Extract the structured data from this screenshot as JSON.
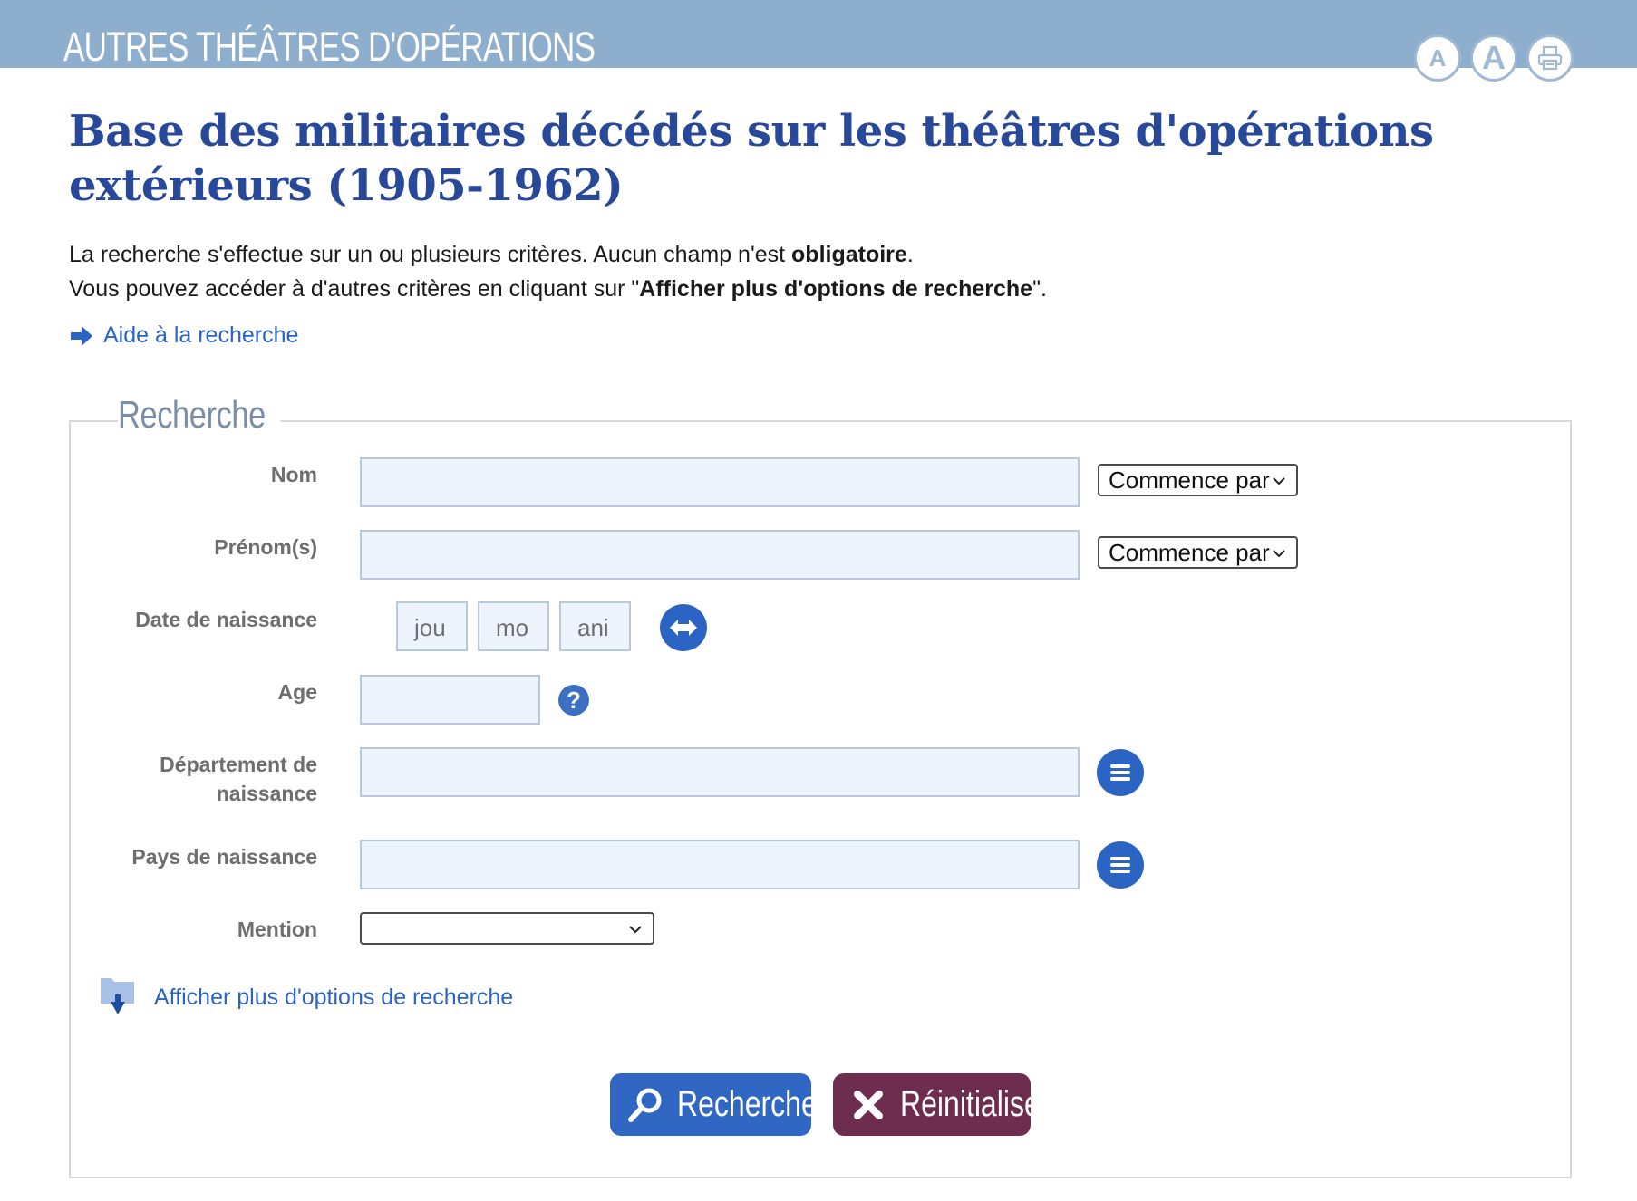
{
  "header": {
    "title": "AUTRES THÉÂTRES D'OPÉRATIONS",
    "font_small_label": "A",
    "font_big_label": "A"
  },
  "page": {
    "title": "Base des militaires décédés sur les théâtres d'opérations extérieurs (1905-1962)",
    "intro_line1_prefix": "La recherche s'effectue sur un ou plusieurs critères. Aucun champ n'est ",
    "intro_line1_bold": "obligatoire",
    "intro_line1_suffix": ".",
    "intro_line2_prefix": "Vous pouvez accéder à d'autres critères en cliquant sur \"",
    "intro_line2_bold": "Afficher plus d'options de recherche",
    "intro_line2_suffix": "\".",
    "help_link": "Aide à la recherche"
  },
  "form": {
    "legend": "Recherche",
    "nom_label": "Nom",
    "nom_value": "",
    "nom_match": "Commence par",
    "prenom_label": "Prénom(s)",
    "prenom_value": "",
    "prenom_match": "Commence par",
    "date_label": "Date de naissance",
    "date_day_placeholder": "jou",
    "date_month_placeholder": "mo",
    "date_year_placeholder": "ani",
    "age_label": "Age",
    "age_value": "",
    "departement_label_line1": "Département de",
    "departement_label_line2": "naissance",
    "departement_value": "",
    "pays_label": "Pays de naissance",
    "pays_value": "",
    "mention_label": "Mention",
    "mention_value": "",
    "more_options": "Afficher plus d'options de recherche",
    "search_button": "Rechercher",
    "reset_button": "Réinitialiser"
  },
  "colors": {
    "header_bg": "#8eaecd",
    "title": "#28489a",
    "link": "#2c64c4",
    "search_button": "#2f67c2",
    "reset_button": "#6e2d4f",
    "input_bg": "#eef4fd"
  },
  "icons": {
    "help_link": "arrow-right-icon",
    "print": "print-icon",
    "date_swap": "swap-arrows-icon",
    "age_help": "question-icon",
    "list": "list-icon",
    "more_options": "folder-down-icon",
    "search": "magnifier-icon",
    "reset": "cross-icon"
  }
}
